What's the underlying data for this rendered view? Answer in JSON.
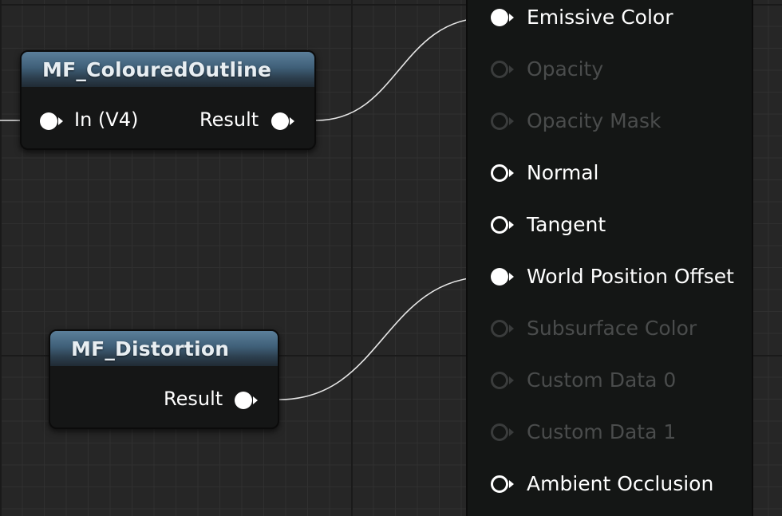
{
  "nodes": {
    "coloured_outline": {
      "title": "MF_ColouredOutline",
      "input_label": "In (V4)",
      "output_label": "Result"
    },
    "distortion": {
      "title": "MF_Distortion",
      "output_label": "Result"
    }
  },
  "material_inputs": [
    {
      "label": "Emissive Color",
      "connected": true,
      "enabled": true
    },
    {
      "label": "Opacity",
      "connected": false,
      "enabled": false
    },
    {
      "label": "Opacity Mask",
      "connected": false,
      "enabled": false
    },
    {
      "label": "Normal",
      "connected": false,
      "enabled": true
    },
    {
      "label": "Tangent",
      "connected": false,
      "enabled": true
    },
    {
      "label": "World Position Offset",
      "connected": true,
      "enabled": true
    },
    {
      "label": "Subsurface Color",
      "connected": false,
      "enabled": false
    },
    {
      "label": "Custom Data 0",
      "connected": false,
      "enabled": false
    },
    {
      "label": "Custom Data 1",
      "connected": false,
      "enabled": false
    },
    {
      "label": "Ambient Occlusion",
      "connected": false,
      "enabled": true
    }
  ],
  "colors": {
    "header_blue": "#3f5f78",
    "node_body": "#151616",
    "wire": "#e6e6e6",
    "disabled_text": "#4a4c4c"
  }
}
